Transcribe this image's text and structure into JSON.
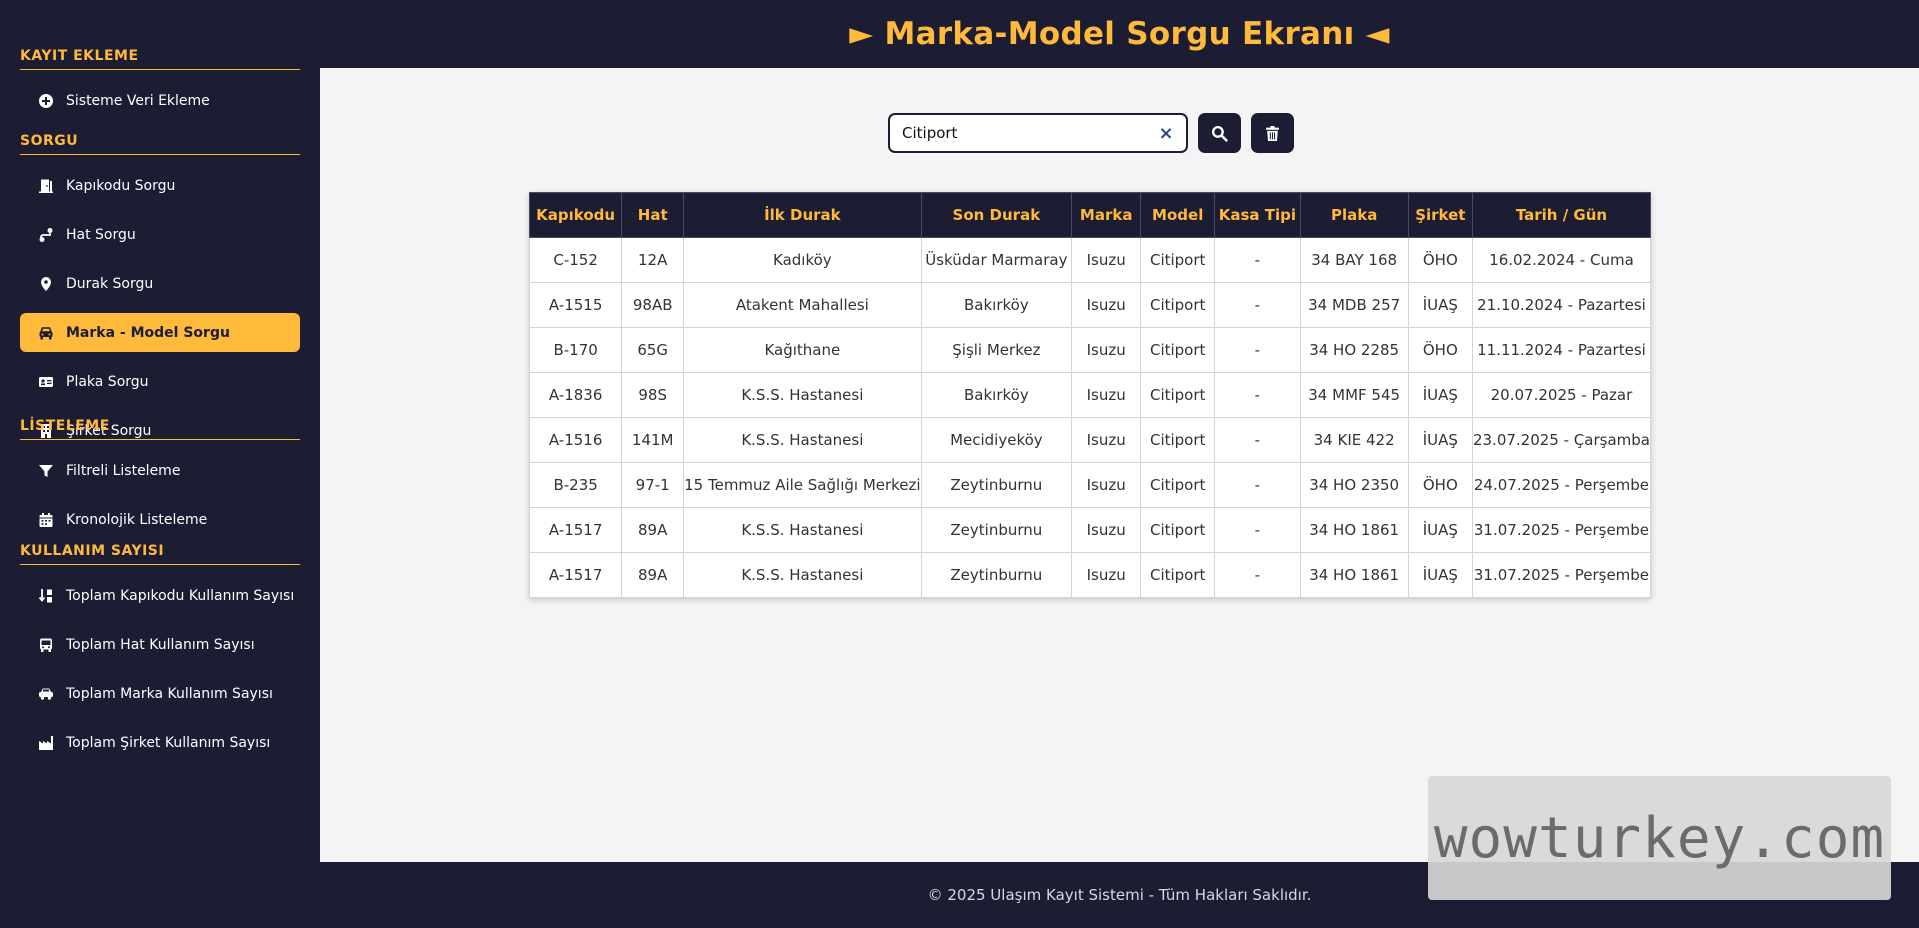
{
  "header": {
    "title": "► Marka-Model Sorgu Ekranı ◄"
  },
  "sidebar": {
    "sections": [
      {
        "title": "KAYIT EKLEME",
        "items": [
          {
            "label": "Sisteme Veri Ekleme",
            "icon": "plus-circle-icon"
          }
        ]
      },
      {
        "title": "SORGU",
        "items": [
          {
            "label": "Kapıkodu Sorgu",
            "icon": "door-icon"
          },
          {
            "label": "Hat Sorgu",
            "icon": "route-icon"
          },
          {
            "label": "Durak Sorgu",
            "icon": "location-pin-icon"
          },
          {
            "label": "Marka - Model Sorgu",
            "icon": "car-icon",
            "active": true
          },
          {
            "label": "Plaka Sorgu",
            "icon": "id-card-icon"
          },
          {
            "label": "Şirket Sorgu",
            "icon": "building-icon"
          }
        ]
      },
      {
        "title": "LİSTELEME",
        "items": [
          {
            "label": "Filtreli Listeleme",
            "icon": "filter-icon"
          },
          {
            "label": "Kronolojik Listeleme",
            "icon": "calendar-icon"
          }
        ]
      },
      {
        "title": "KULLANIM SAYISI",
        "items": [
          {
            "label": "Toplam Kapıkodu Kullanım Sayısı",
            "icon": "sort-icon"
          },
          {
            "label": "Toplam Hat Kullanım Sayısı",
            "icon": "bus-icon"
          },
          {
            "label": "Toplam Marka Kullanım Sayısı",
            "icon": "cars-icon"
          },
          {
            "label": "Toplam Şirket Kullanım Sayısı",
            "icon": "industry-icon"
          }
        ]
      }
    ]
  },
  "search": {
    "value": "Citiport",
    "clear_label": "×"
  },
  "table": {
    "columns": [
      "Kapıkodu",
      "Hat",
      "İlk Durak",
      "Son Durak",
      "Marka",
      "Model",
      "Kasa Tipi",
      "Plaka",
      "Şirket",
      "Tarih / Gün"
    ],
    "rows": [
      [
        "C-152",
        "12A",
        "Kadıköy",
        "Üsküdar Marmaray",
        "Isuzu",
        "Citiport",
        "-",
        "34 BAY 168",
        "ÖHO",
        "16.02.2024 - Cuma"
      ],
      [
        "A-1515",
        "98AB",
        "Atakent Mahallesi",
        "Bakırköy",
        "Isuzu",
        "Citiport",
        "-",
        "34 MDB 257",
        "İUAŞ",
        "21.10.2024 - Pazartesi"
      ],
      [
        "B-170",
        "65G",
        "Kağıthane",
        "Şişli Merkez",
        "Isuzu",
        "Citiport",
        "-",
        "34 HO 2285",
        "ÖHO",
        "11.11.2024 - Pazartesi"
      ],
      [
        "A-1836",
        "98S",
        "K.S.S. Hastanesi",
        "Bakırköy",
        "Isuzu",
        "Citiport",
        "-",
        "34 MMF 545",
        "İUAŞ",
        "20.07.2025 - Pazar"
      ],
      [
        "A-1516",
        "141M",
        "K.S.S. Hastanesi",
        "Mecidiyeköy",
        "Isuzu",
        "Citiport",
        "-",
        "34 KIE 422",
        "İUAŞ",
        "23.07.2025 - Çarşamba"
      ],
      [
        "B-235",
        "97-1",
        "15 Temmuz Aile Sağlığı Merkezi",
        "Zeytinburnu",
        "Isuzu",
        "Citiport",
        "-",
        "34 HO 2350",
        "ÖHO",
        "24.07.2025 - Perşembe"
      ],
      [
        "A-1517",
        "89A",
        "K.S.S. Hastanesi",
        "Zeytinburnu",
        "Isuzu",
        "Citiport",
        "-",
        "34 HO 1861",
        "İUAŞ",
        "31.07.2025 - Perşembe"
      ],
      [
        "A-1517",
        "89A",
        "K.S.S. Hastanesi",
        "Zeytinburnu",
        "Isuzu",
        "Citiport",
        "-",
        "34 HO 1861",
        "İUAŞ",
        "31.07.2025 - Perşembe"
      ]
    ]
  },
  "footer": {
    "text": "© 2025 Ulaşım Kayıt Sistemi - Tüm Hakları Saklıdır."
  },
  "watermark": {
    "text": "wowturkey.com"
  },
  "colors": {
    "accent": "#ffb93b",
    "dark": "#1c1c33",
    "content_bg": "#f4f4f4"
  }
}
